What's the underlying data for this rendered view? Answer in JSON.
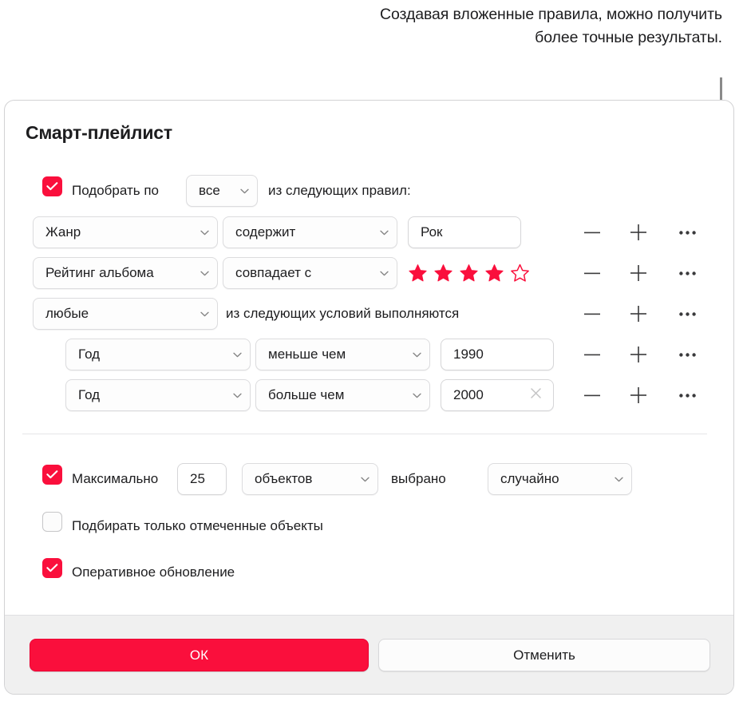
{
  "callout": {
    "text": "Создавая вложенные правила, можно получить более точные результаты."
  },
  "dialog": {
    "title": "Смарт-плейлист",
    "match": {
      "checkbox_checked": true,
      "prefix_label": "Подобрать по",
      "selector_value": "все",
      "suffix_label": "из следующих правил:"
    },
    "rules": [
      {
        "field": "Жанр",
        "operator": "содержит",
        "value_type": "text",
        "value": "Рок",
        "clear_button": false,
        "indent": 0
      },
      {
        "field": "Рейтинг альбома",
        "operator": "совпадает с",
        "value_type": "stars",
        "stars_filled": 4,
        "stars_total": 5,
        "indent": 0
      },
      {
        "field": "любые",
        "operator": "",
        "value_type": "nested-header",
        "nested_label": "из следующих условий выполняются",
        "indent": 0
      },
      {
        "field": "Год",
        "operator": "меньше чем",
        "value_type": "text",
        "value": "1990",
        "clear_button": false,
        "indent": 1
      },
      {
        "field": "Год",
        "operator": "больше чем",
        "value_type": "text",
        "value": "2000",
        "clear_button": true,
        "indent": 1
      }
    ],
    "row_actions": {
      "remove_label": "—",
      "add_label": "+",
      "more_label": "•••"
    },
    "limit": {
      "checkbox_checked": true,
      "label": "Максимально",
      "amount": "25",
      "unit": "объектов",
      "selected_by_label": "выбрано",
      "selected_by": "случайно"
    },
    "only_checked": {
      "checkbox_checked": false,
      "label": "Подбирать только отмеченные объекты"
    },
    "live_update": {
      "checkbox_checked": true,
      "label": "Оперативное обновление"
    },
    "footer": {
      "ok_label": "ОК",
      "cancel_label": "Отменить"
    }
  },
  "colors": {
    "accent": "#fa0f3c",
    "text": "#1d1d1f",
    "footer_bg": "#f0f0f0",
    "border": "#d2d2d4",
    "callout_line": "#8a8a8a"
  }
}
